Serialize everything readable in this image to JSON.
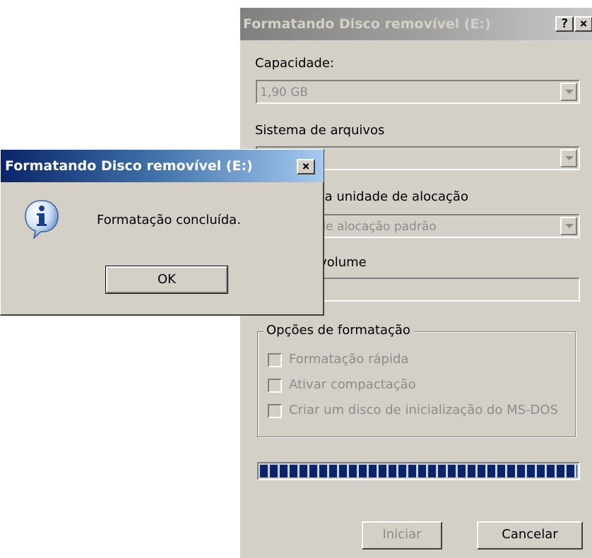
{
  "format_window": {
    "title": "Formatando Disco removível (E:)",
    "help_label": "?",
    "close_label": "×",
    "capacity_label": "Capacidade:",
    "capacity_value": "1,90 GB",
    "filesystem_label": "Sistema de arquivos",
    "filesystem_value": "",
    "allocation_label": "Tamanho da unidade de alocação",
    "allocation_value": "Tamanho de alocação padrão",
    "volume_label": "Rótulo do volume",
    "volume_value": "",
    "options_group": "Opções de formatação",
    "options": [
      "Formatação rápida",
      "Ativar compactação",
      "Criar um disco de inicialização do MS-DOS"
    ],
    "progress": 1.0,
    "progress_color": "#0a246a",
    "start_button": "Iniciar",
    "cancel_button": "Cancelar"
  },
  "message_box": {
    "title": "Formatando Disco removível (E:)",
    "close_label": "×",
    "icon": "info-icon",
    "message": "Formatação concluída.",
    "ok_button": "OK"
  }
}
